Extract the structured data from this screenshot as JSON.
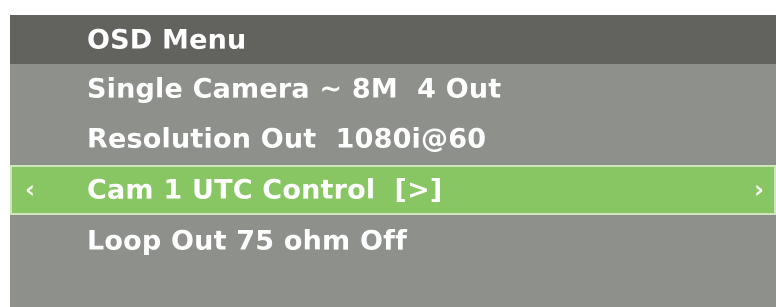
{
  "osd": {
    "title": "OSD Menu",
    "items": [
      {
        "label": "Single Camera ~ 8M  4 Out",
        "selected": false
      },
      {
        "label": "Resolution Out  1080i@60",
        "selected": false
      },
      {
        "label": "Cam 1 UTC Control  [>]",
        "selected": true,
        "nav_left": "‹",
        "nav_right": "›"
      },
      {
        "label": "Loop Out 75 ohm Off",
        "selected": false
      }
    ]
  },
  "colors": {
    "header_bg": "#62635f",
    "panel_bg": "#8e908b",
    "selected_bg": "#88c663",
    "text": "#ffffff"
  }
}
